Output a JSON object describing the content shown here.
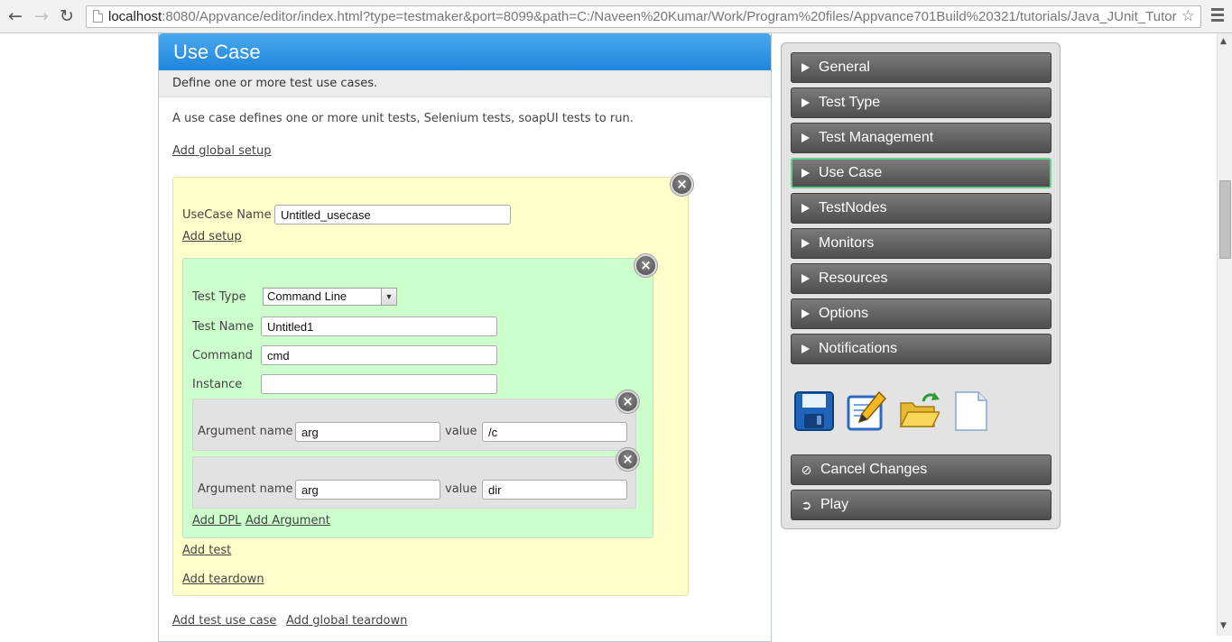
{
  "browser": {
    "back_icon": "arrow-left-icon",
    "forward_icon": "arrow-right-icon",
    "reload_icon": "reload-icon",
    "url_host": "localhost",
    "url_rest": ":8080/Appvance/editor/index.html?type=testmaker&port=8099&path=C:/Naveen%20Kumar/Work/Program%20files/Appvance701Build%20321/tutorials/Java_JUnit_Tutor"
  },
  "usecase": {
    "title": "Use Case",
    "description": "Define one or more test use cases.",
    "intro": "A use case defines one or more unit tests, Selenium tests, soapUI tests to run.",
    "add_global_setup": "Add global setup",
    "name_label": "UseCase Name",
    "name_value": "Untitled_usecase",
    "add_setup": "Add setup",
    "test": {
      "type_label": "Test Type",
      "type_value": "Command Line",
      "name_label": "Test Name",
      "name_value": "Untitled1",
      "command_label": "Command",
      "command_value": "cmd",
      "instance_label": "Instance",
      "instance_value": "",
      "arguments": [
        {
          "name_label": "Argument name",
          "name_value": "arg",
          "value_label": "value",
          "value": "/c"
        },
        {
          "name_label": "Argument name",
          "name_value": "arg",
          "value_label": "value",
          "value": "dir"
        }
      ],
      "add_dpl": "Add DPL",
      "add_argument": "Add Argument"
    },
    "add_test": "Add test",
    "add_teardown": "Add teardown",
    "add_test_use_case": "Add test use case",
    "add_global_teardown": "Add global teardown"
  },
  "sidebar": {
    "items": [
      {
        "label": "General"
      },
      {
        "label": "Test Type"
      },
      {
        "label": "Test Management"
      },
      {
        "label": "Use Case",
        "active": true
      },
      {
        "label": "TestNodes"
      },
      {
        "label": "Monitors"
      },
      {
        "label": "Resources"
      },
      {
        "label": "Options"
      },
      {
        "label": "Notifications"
      }
    ],
    "tools": [
      "save-icon",
      "edit-icon",
      "open-folder-icon",
      "new-document-icon"
    ],
    "cancel_label": "Cancel Changes",
    "play_label": "Play"
  },
  "colors": {
    "header_blue": "#2a90e2",
    "usecase_bg": "#ffffcc",
    "test_bg": "#ccffcc",
    "argument_bg": "#e2e2e2",
    "nav_button": "#5e5e5e",
    "active_border": "#67cf89"
  }
}
